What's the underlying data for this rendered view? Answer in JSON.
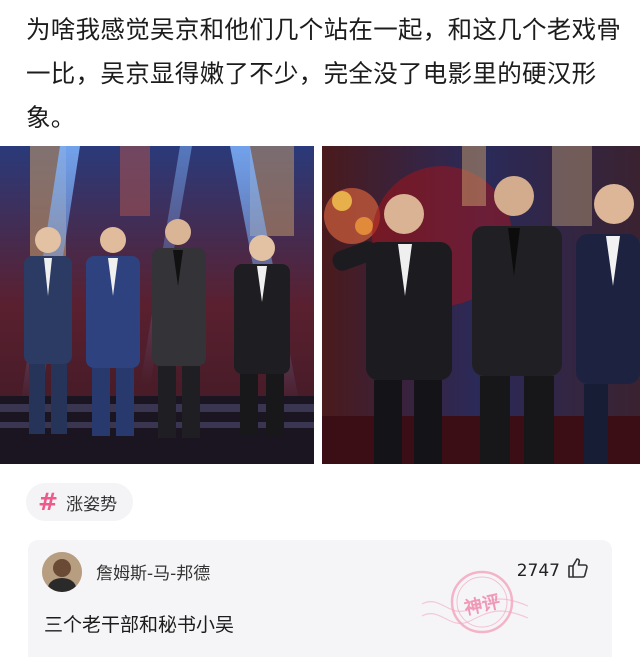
{
  "post": {
    "text": "为啥我感觉吴京和他们几个站在一起，和这几个老戏骨一比，吴京显得嫩了不少，完全没了电影里的硬汉形象。"
  },
  "tag": {
    "icon": "hash-icon",
    "label": "涨姿势",
    "color": "#ee5a8a"
  },
  "comment": {
    "username": "詹姆斯-马-邦德",
    "likes": "2747",
    "text": "三个老干部和秘书小吴",
    "stamp_text": "神评",
    "stamp_color": "#f3a8c0"
  }
}
